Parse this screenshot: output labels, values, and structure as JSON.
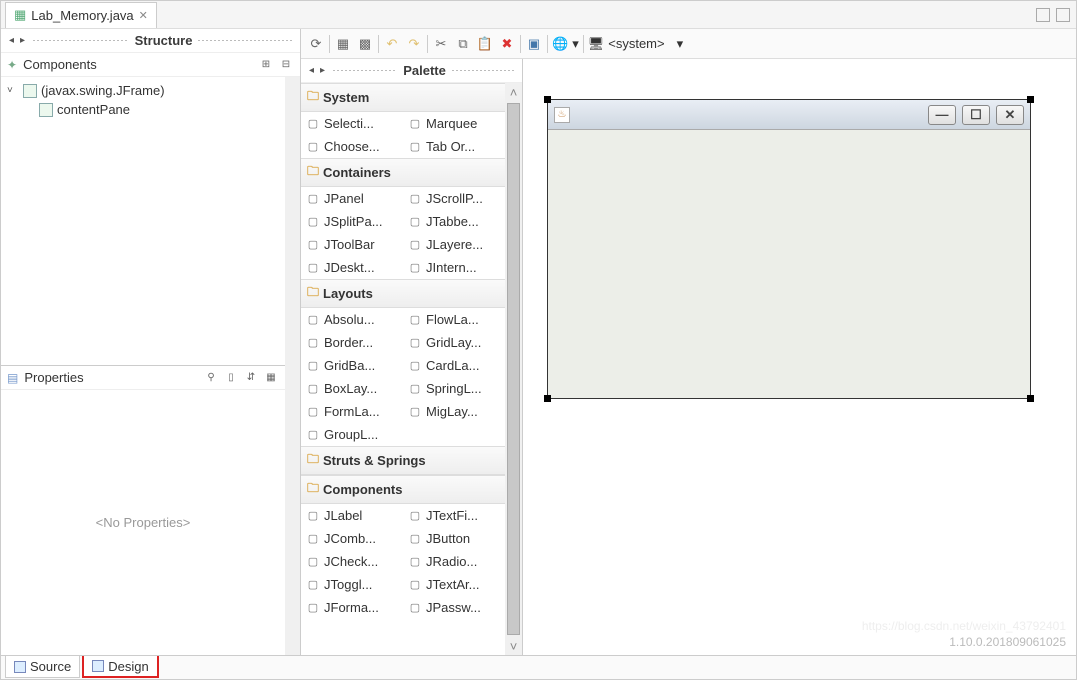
{
  "tab": {
    "title": "Lab_Memory.java"
  },
  "structure": {
    "title": "Structure",
    "components_label": "Components",
    "root": "(javax.swing.JFrame)",
    "child": "contentPane"
  },
  "properties": {
    "title": "Properties",
    "empty": "<No Properties>"
  },
  "palette": {
    "title": "Palette",
    "categories": [
      {
        "name": "System",
        "items": [
          "Selecti...",
          "Marquee",
          "Choose...",
          "Tab Or..."
        ]
      },
      {
        "name": "Containers",
        "items": [
          "JPanel",
          "JScrollP...",
          "JSplitPa...",
          "JTabbe...",
          "JToolBar",
          "JLayere...",
          "JDeskt...",
          "JIntern..."
        ]
      },
      {
        "name": "Layouts",
        "items": [
          "Absolu...",
          "FlowLa...",
          "Border...",
          "GridLay...",
          "GridBa...",
          "CardLa...",
          "BoxLay...",
          "SpringL...",
          "FormLa...",
          "MigLay...",
          "GroupL..."
        ]
      },
      {
        "name": "Struts & Springs",
        "items": []
      },
      {
        "name": "Components",
        "items": [
          "JLabel",
          "JTextFi...",
          "JComb...",
          "JButton",
          "JCheck...",
          "JRadio...",
          "JToggl...",
          "JTextAr...",
          "JForma...",
          "JPassw..."
        ]
      }
    ]
  },
  "toolbar": {
    "system_label": "<system>"
  },
  "bottom": {
    "source": "Source",
    "design": "Design"
  },
  "footer": {
    "version": "1.10.0.201809061025",
    "watermark": "https://blog.csdn.net/weixin_43792401"
  }
}
